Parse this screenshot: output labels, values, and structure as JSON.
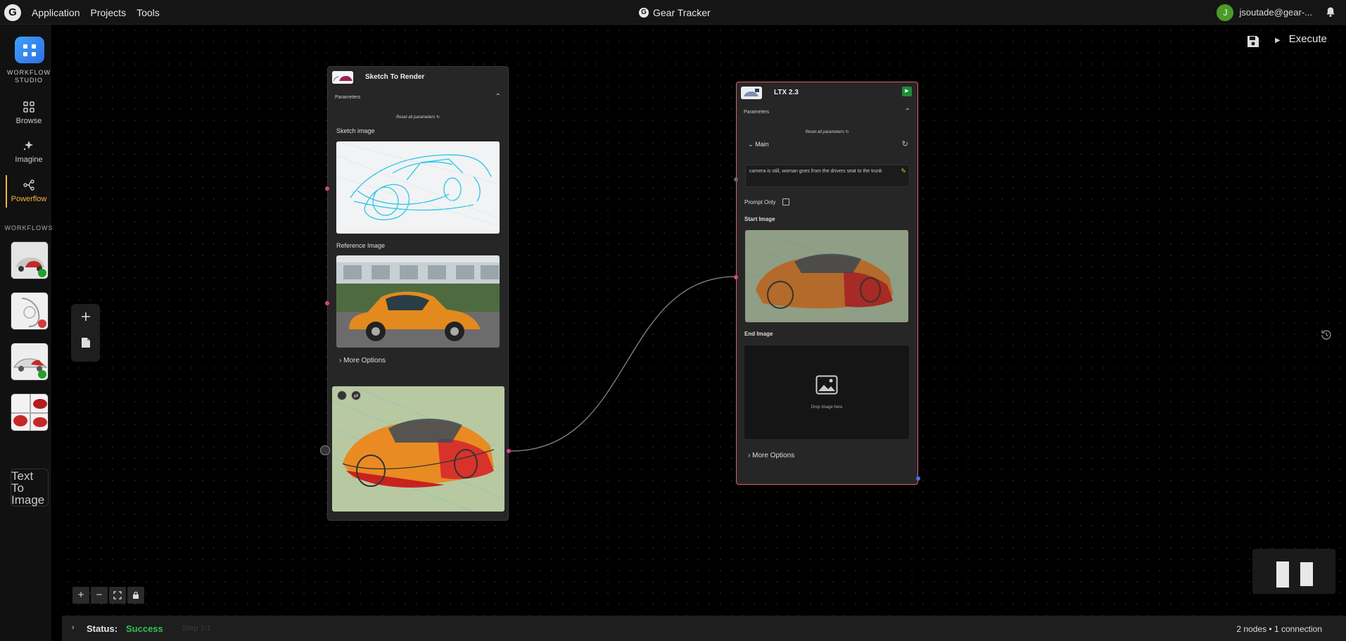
{
  "topbar": {
    "logo_letter": "G",
    "menu": [
      "Application",
      "Projects",
      "Tools"
    ],
    "app_title": "Gear Tracker",
    "user_initial": "J",
    "user_email": "jsoutade@gear-..."
  },
  "sidebar": {
    "studio_label": "WORKFLOW STUDIO",
    "nav": [
      {
        "label": "Browse",
        "icon": "grid-icon"
      },
      {
        "label": "Imagine",
        "icon": "sparkle-icon"
      },
      {
        "label": "Powerflow",
        "icon": "flow-icon"
      }
    ],
    "workflows_label": "WORKFLOWS",
    "workflows": [
      {
        "status_color": "#1fa12b"
      },
      {
        "status_color": "#d43a3a"
      },
      {
        "status_color": "#1fa12b"
      },
      {
        "status_color": null
      }
    ],
    "text_to_image_alt": "Text To Image"
  },
  "toolbar": {
    "execute_label": "Execute"
  },
  "node_sketch": {
    "title": "Sketch To Render",
    "parameters_label": "Parameters",
    "reset_label": "Reset all parameters",
    "sketch_label": "Sketch image",
    "reference_label": "Reference Image",
    "more_options": "More Options"
  },
  "node_ltx": {
    "title": "LTX 2.3",
    "parameters_label": "Parameters",
    "reset_label": "Reset all parameters",
    "main_label": "Main",
    "prompt_text": "camera is still, woman goes from the drivers seat to the trunk",
    "prompt_only_label": "Prompt Only",
    "start_label": "Start Image",
    "end_label": "End Image",
    "drop_text": "Drop image here",
    "more_options": "More Options"
  },
  "status": {
    "label": "Status:",
    "value": "Success",
    "step": "Step 1/1",
    "count": "2 nodes • 1 connection"
  },
  "colors": {
    "accent": "#f0b43c",
    "success": "#34c34a",
    "node_selected_border": "#e0606a",
    "port": "#e0408a"
  }
}
